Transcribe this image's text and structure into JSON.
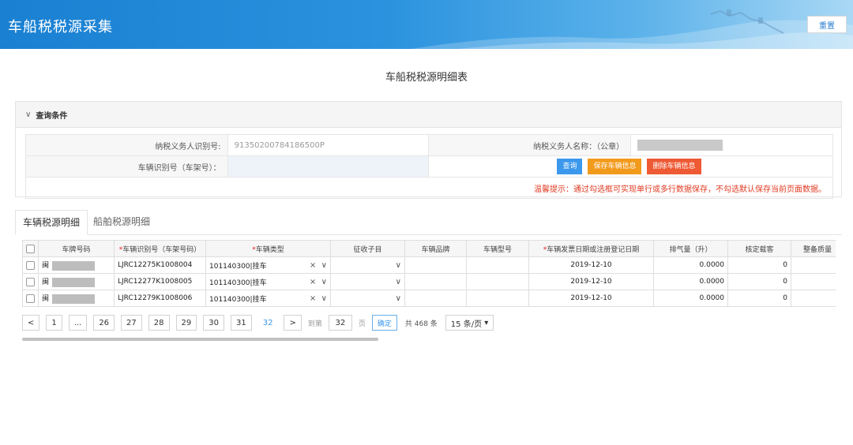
{
  "header": {
    "title": "车船税税源采集",
    "reset_label": "重置"
  },
  "page_title": "车船税税源明细表",
  "query": {
    "section_title": "查询条件",
    "taxpayer_id_label": "纳税义务人识别号:",
    "taxpayer_id_value": "91350200784186500P",
    "taxpayer_name_label": "纳税义务人名称：（公章）",
    "vin_label": "车辆识别号（车架号）：",
    "vin_value": "",
    "buttons": {
      "search": "查询",
      "save": "保存车辆信息",
      "delete": "删除车辆信息"
    },
    "tip": "温馨提示：通过勾选框可实现单行或多行数据保存，不勾选默认保存当前页面数据。"
  },
  "tabs": [
    {
      "label": "车辆税源明细",
      "active": true
    },
    {
      "label": "船舶税源明细",
      "active": false
    }
  ],
  "grid": {
    "columns": {
      "plate": "车牌号码",
      "vin": "车辆识别号（车架号码）",
      "vtype": "车辆类型",
      "subject": "征收子目",
      "brand": "车辆品牌",
      "model": "车辆型号",
      "date": "车辆发票日期或注册登记日期",
      "disp": "排气量（升）",
      "seats": "核定载客",
      "mass": "整备质量"
    },
    "rows": [
      {
        "plate_prefix": "闽",
        "vin": "LJRC12275K1008004",
        "vtype": "101140300|挂车",
        "subject": "",
        "brand": "",
        "model": "",
        "date": "2019-12-10",
        "disp": "0.0000",
        "seats": "0",
        "mass": ""
      },
      {
        "plate_prefix": "闽",
        "vin": "LJRC12277K1008005",
        "vtype": "101140300|挂车",
        "subject": "",
        "brand": "",
        "model": "",
        "date": "2019-12-10",
        "disp": "0.0000",
        "seats": "0",
        "mass": ""
      },
      {
        "plate_prefix": "闽",
        "vin": "LJRC12279K1008006",
        "vtype": "101140300|挂车",
        "subject": "",
        "brand": "",
        "model": "",
        "date": "2019-12-10",
        "disp": "0.0000",
        "seats": "0",
        "mass": ""
      }
    ]
  },
  "pagination": {
    "prev": "<",
    "next": ">",
    "pages": [
      "1",
      "...",
      "26",
      "27",
      "28",
      "29",
      "30",
      "31"
    ],
    "current": "32",
    "goto_label": "到第",
    "goto_value": "32",
    "page_unit": "页",
    "confirm": "确定",
    "total": "共 468 条",
    "page_size": "15 条/页"
  }
}
